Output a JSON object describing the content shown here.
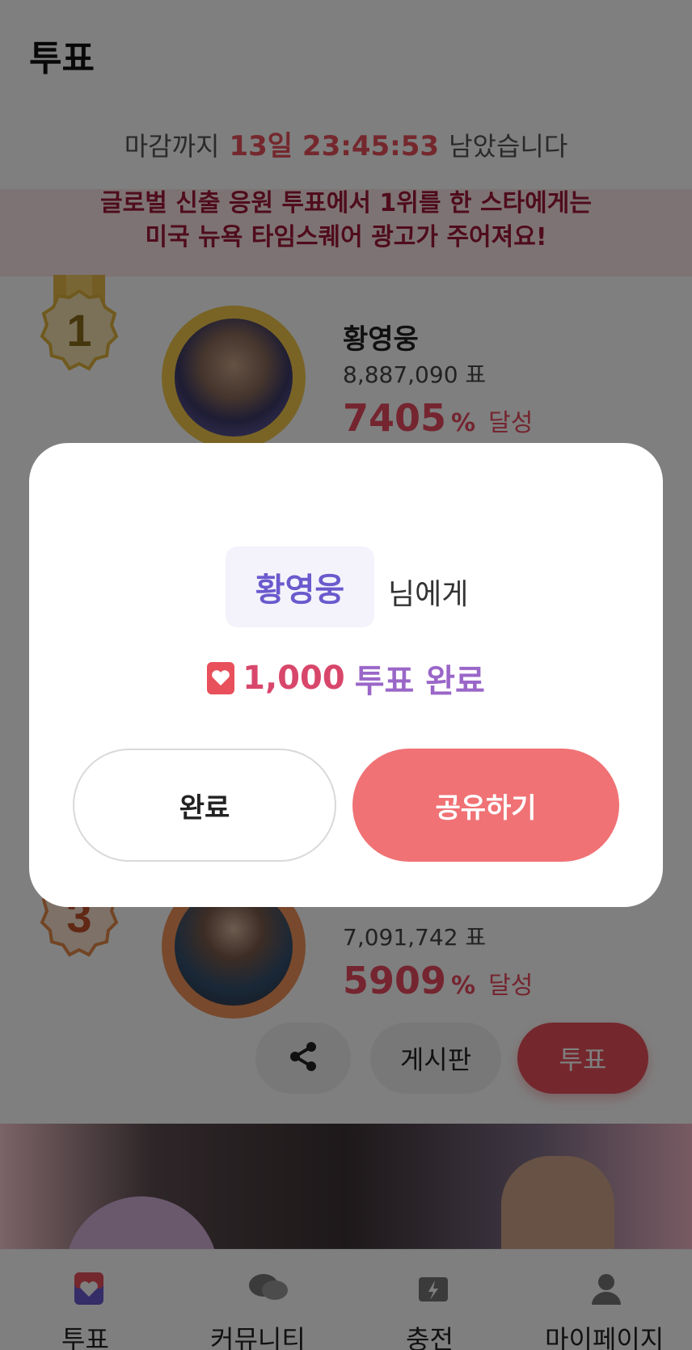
{
  "header": {
    "title": "투표"
  },
  "deadline": {
    "prefix": "마감까지",
    "time": "13일 23:45:53",
    "suffix": "남았습니다"
  },
  "banner": {
    "line1": "글로벌 신출 응원 투표에서 1위를 한 스타에게는",
    "line2": "미국 뉴욕 타임스퀘어 광고가 주어져요!"
  },
  "ranking": [
    {
      "rank": "1",
      "name": "황영웅",
      "votes": "8,887,090 표",
      "percent": "7405",
      "percent_unit": "%",
      "achieve": "달성",
      "medal_color": "#e0b23c"
    },
    {
      "rank": "3",
      "name": "",
      "votes": "7,091,742 표",
      "percent": "5909",
      "percent_unit": "%",
      "achieve": "달성",
      "medal_color": "#e58a4a"
    }
  ],
  "actions": {
    "board": "게시판",
    "vote": "투표"
  },
  "promo": {
    "text": "글로벌 신출 응원"
  },
  "bottom_nav": [
    {
      "label": "투표",
      "icon": "vote-heart-icon"
    },
    {
      "label": "커뮤니티",
      "icon": "chat-bubbles-icon"
    },
    {
      "label": "충전",
      "icon": "charge-bolt-icon"
    },
    {
      "label": "마이페이지",
      "icon": "person-icon"
    }
  ],
  "modal": {
    "recipient": "황영웅",
    "recipient_suffix": "님에게",
    "vote_amount": "1,000",
    "vote_label": "투표 완료",
    "done_button": "완료",
    "share_button": "공유하기"
  },
  "colors": {
    "accent": "#e8505b",
    "purple": "#6a5acd"
  }
}
